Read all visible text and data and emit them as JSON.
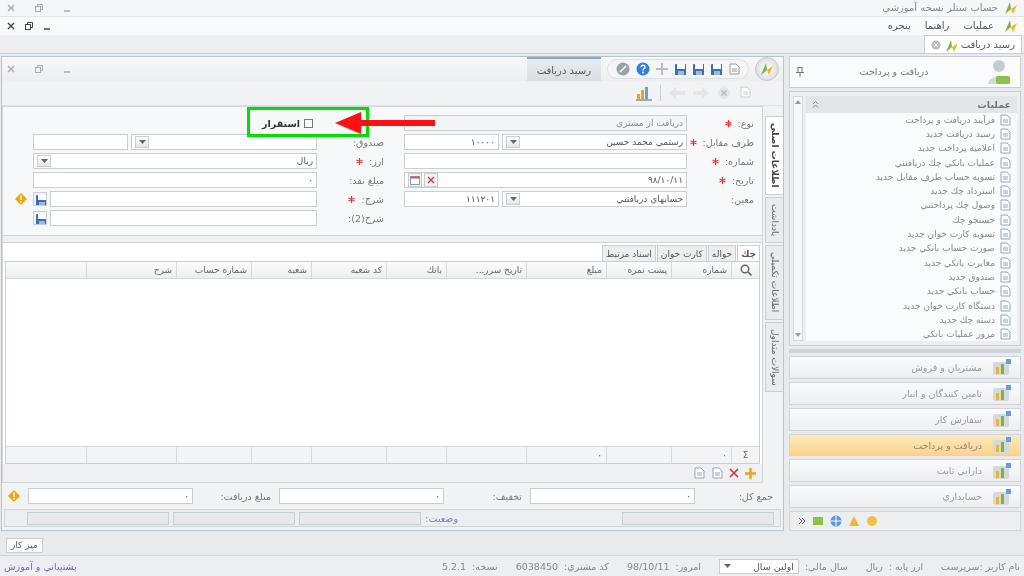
{
  "app_title": "حساب ستلر نسخه آموزشي",
  "menu": [
    {
      "label": "عمليات"
    },
    {
      "label": "راهنما"
    },
    {
      "label": "پنجره"
    }
  ],
  "doc_tabs": [
    {
      "label": "رسيد دريافت",
      "selected": true
    }
  ],
  "form": {
    "title": "رسيد دريافت",
    "right_fields": [
      {
        "kind": "combo",
        "label": "نوع:",
        "required": true,
        "value": "دريافت از مشتري",
        "disabled": true
      },
      {
        "kind": "pair",
        "label": "طرف مقابل:",
        "required": true,
        "code": "۱۰۰۰۰",
        "value": "رستمي محمد حسين"
      },
      {
        "kind": "text",
        "label": "شماره:",
        "required": true
      },
      {
        "kind": "date",
        "label": "تاريخ:",
        "required": true,
        "value": "۹۸/۱۰/۱۱"
      },
      {
        "kind": "pair",
        "label": "معين:",
        "required": false,
        "code": "۱۱۱۲۰۱",
        "value": "حسابهاي دريافتني"
      }
    ],
    "left_fields": [
      {
        "kind": "checkbox",
        "label": "استقرار",
        "checked": false
      },
      {
        "kind": "pair",
        "label": "صندوق:",
        "required": false
      },
      {
        "kind": "combo",
        "label": "ارز:",
        "required": true,
        "value": "ريال",
        "disabled": false
      },
      {
        "kind": "number",
        "label": "مبلغ نقد:",
        "required": false,
        "value": "٠"
      },
      {
        "kind": "memo",
        "label": "شرح:",
        "required": true,
        "warning": true
      },
      {
        "kind": "memo",
        "label": "شرح(2):",
        "required": false,
        "warning": false
      }
    ],
    "annotations": [
      {
        "kind": "highlight-box"
      },
      {
        "kind": "arrow"
      }
    ],
    "side_tabs": [
      {
        "label": "اطلاعات اصلي",
        "selected": true
      },
      {
        "label": "يادداشت",
        "selected": false
      },
      {
        "label": "اطلاعات تكميلي",
        "selected": false
      },
      {
        "label": "سوالات متداول",
        "selected": false
      }
    ],
    "detail_tabs": [
      {
        "label": "چك",
        "selected": true
      },
      {
        "label": "حواله",
        "selected": false
      },
      {
        "label": "كارت خوان",
        "selected": false
      },
      {
        "label": "اسناد مرتبط",
        "selected": false
      }
    ],
    "grid": {
      "sum_symbol": "Σ",
      "columns": [
        {
          "label": "شماره",
          "total": "٠"
        },
        {
          "label": "پشت نمره"
        },
        {
          "label": "مبلغ",
          "total": "٠"
        },
        {
          "label": "تاريخ سرر..."
        },
        {
          "label": "بانك"
        },
        {
          "label": "كد شعبه"
        },
        {
          "label": "شعبه"
        },
        {
          "label": "شماره حساب"
        },
        {
          "label": "شرح"
        }
      ]
    },
    "totals": [
      {
        "label": "جمع كل:",
        "value": "٠",
        "warning": false
      },
      {
        "label": "تخفيف:",
        "value": "٠",
        "warning": false
      },
      {
        "label": "مبلغ دريافت:",
        "value": "٠",
        "warning": true
      }
    ],
    "status_label": "وضعيت:"
  },
  "side_panel": {
    "title": "دريافت و پرداخت",
    "group": "عمليات",
    "items": [
      {
        "label": "فرآيند دريافت و پرداخت"
      },
      {
        "label": "رسيد دريافت جديد"
      },
      {
        "label": "اعلاميه پرداخت جديد"
      },
      {
        "label": "عمليات بانكي چك دريافتني"
      },
      {
        "label": "تسويه حساب طرف مقابل جديد"
      },
      {
        "label": "استرداد چك جديد"
      },
      {
        "label": "وصول چك پرداختني"
      },
      {
        "label": "جستجو چك"
      },
      {
        "label": "تسويه كارت خوان جديد"
      },
      {
        "label": "صورت حساب بانكي جديد"
      },
      {
        "label": "مغايرت بانكي جديد"
      },
      {
        "label": "صندوق جديد"
      },
      {
        "label": "حساب بانكي جديد"
      },
      {
        "label": "دستگاه كارت خوان جديد"
      },
      {
        "label": "دسته چك جديد"
      },
      {
        "label": "مرور عمليات بانكي"
      }
    ],
    "nav": [
      {
        "label": "مشتريان و فروش",
        "selected": false
      },
      {
        "label": "تامين كنندگان و انبار",
        "selected": false
      },
      {
        "label": "سفارش كار",
        "selected": false
      },
      {
        "label": "دريافت و پرداخت",
        "selected": true
      },
      {
        "label": "دارايي ثابت",
        "selected": false
      },
      {
        "label": "حسابداري",
        "selected": false
      }
    ]
  },
  "desktop_button": "ميز كار",
  "status_bar": {
    "user": "نام كاربر :سرپرست",
    "fields": [
      {
        "kind": "text",
        "label": "ارز پايه :",
        "value": "ريال"
      },
      {
        "kind": "dropdown",
        "label": "سال مالي:",
        "value": "اولين سال"
      },
      {
        "kind": "text",
        "label": "امروز:",
        "value": "98/10/11"
      },
      {
        "kind": "text",
        "label": "كد مشتري:",
        "value": "6038450"
      },
      {
        "kind": "text",
        "label": "نسخه:",
        "value": "5.2.1"
      }
    ],
    "link": "پشتيباني و آموزش"
  }
}
